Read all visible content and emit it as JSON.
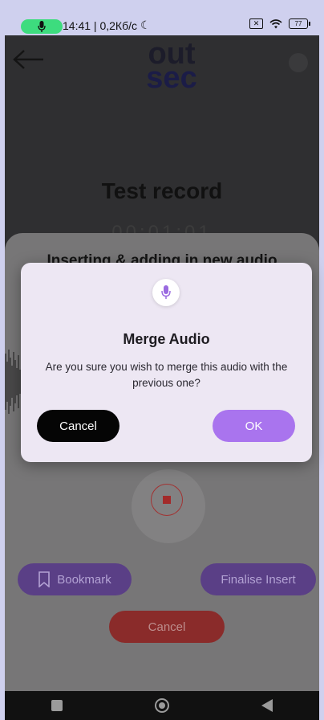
{
  "status_bar": {
    "time_speed": "14:41 | 0,2Кб/с",
    "moon_icon": "☾",
    "battery": "77"
  },
  "header": {
    "logo_line1": "out",
    "logo_line2": "sec"
  },
  "recording": {
    "title": "Test record",
    "timer": "00:01:01"
  },
  "sheet": {
    "title": "Inserting & adding in new audio",
    "bookmark_label": "Bookmark",
    "finalise_label": "Finalise Insert",
    "cancel_label": "Cancel"
  },
  "dialog": {
    "title": "Merge Audio",
    "message": "Are you sure you wish to merge this audio with the previous one?",
    "cancel_label": "Cancel",
    "ok_label": "OK"
  },
  "colors": {
    "accent_purple": "#a974ee",
    "record_red": "#a32a2a",
    "status_green": "#3ddc7e"
  }
}
